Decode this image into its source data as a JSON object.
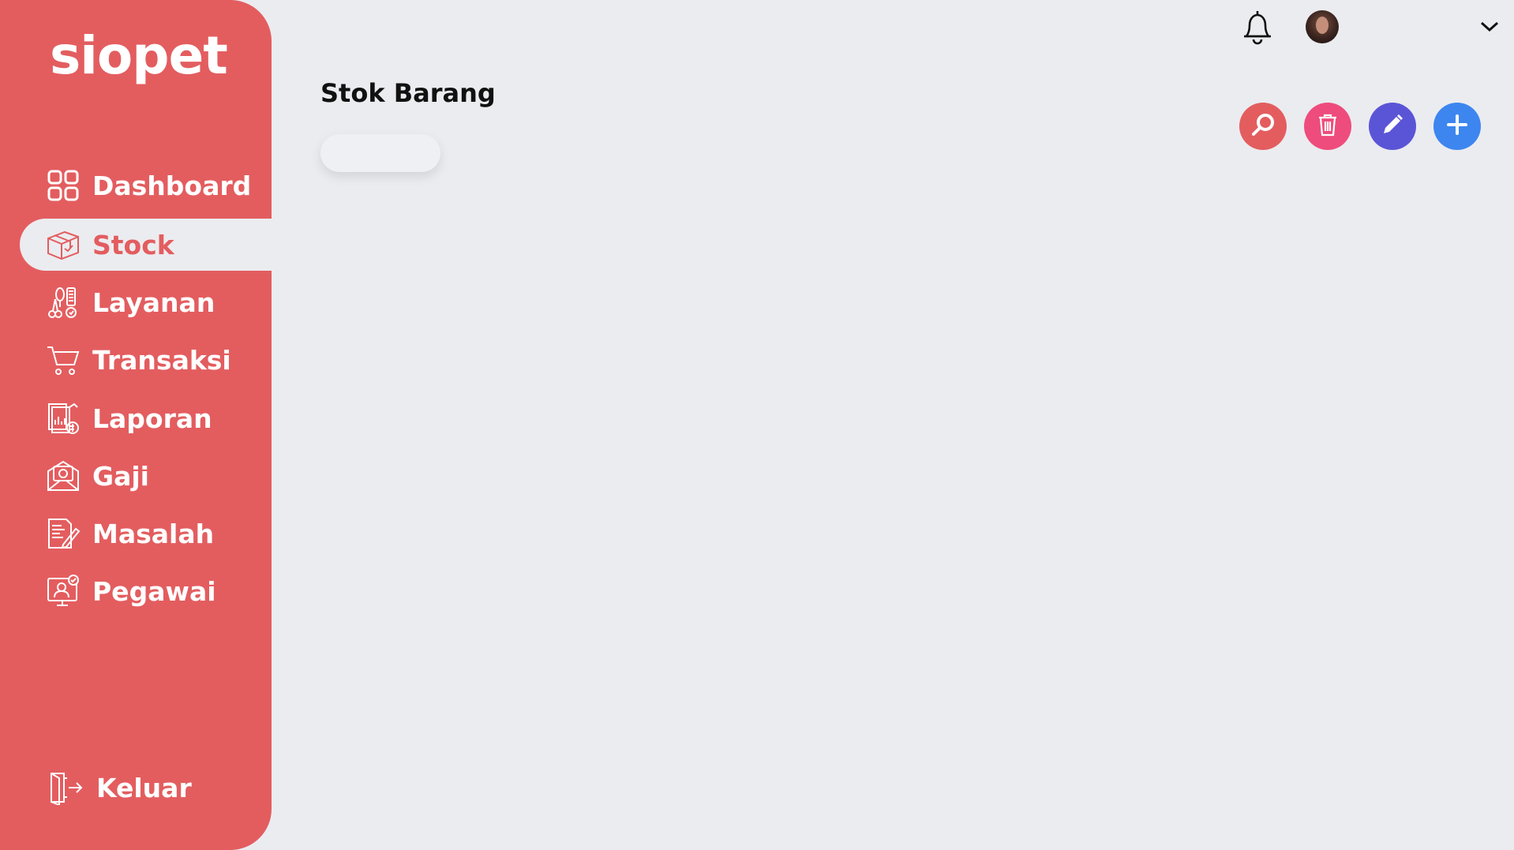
{
  "brand": {
    "name": "siopet",
    "color": "#e35d5f"
  },
  "sidebar": {
    "items": [
      {
        "label": "Dashboard",
        "icon": "grid-icon",
        "active": false
      },
      {
        "label": "Stock",
        "icon": "box-icon",
        "active": true
      },
      {
        "label": "Layanan",
        "icon": "grooming-tools-icon",
        "active": false
      },
      {
        "label": "Transaksi",
        "icon": "cart-icon",
        "active": false
      },
      {
        "label": "Laporan",
        "icon": "report-icon",
        "active": false
      },
      {
        "label": "Gaji",
        "icon": "salary-envelope-icon",
        "active": false
      },
      {
        "label": "Masalah",
        "icon": "issue-document-icon",
        "active": false
      },
      {
        "label": "Pegawai",
        "icon": "employee-icon",
        "active": false
      }
    ],
    "logout_label": "Keluar"
  },
  "header": {
    "notification_icon": "bell-icon",
    "avatar_icon": "user-avatar",
    "dropdown_icon": "chevron-down-icon"
  },
  "main": {
    "title": "Stok Barang",
    "input_value": ""
  },
  "actions": [
    {
      "name": "search",
      "icon": "search-icon",
      "color": "#e35d5f"
    },
    {
      "name": "delete",
      "icon": "trash-icon",
      "color": "#ee4c7c"
    },
    {
      "name": "edit",
      "icon": "pencil-icon",
      "color": "#5a55d6"
    },
    {
      "name": "add",
      "icon": "plus-icon",
      "color": "#3d86ef"
    }
  ]
}
